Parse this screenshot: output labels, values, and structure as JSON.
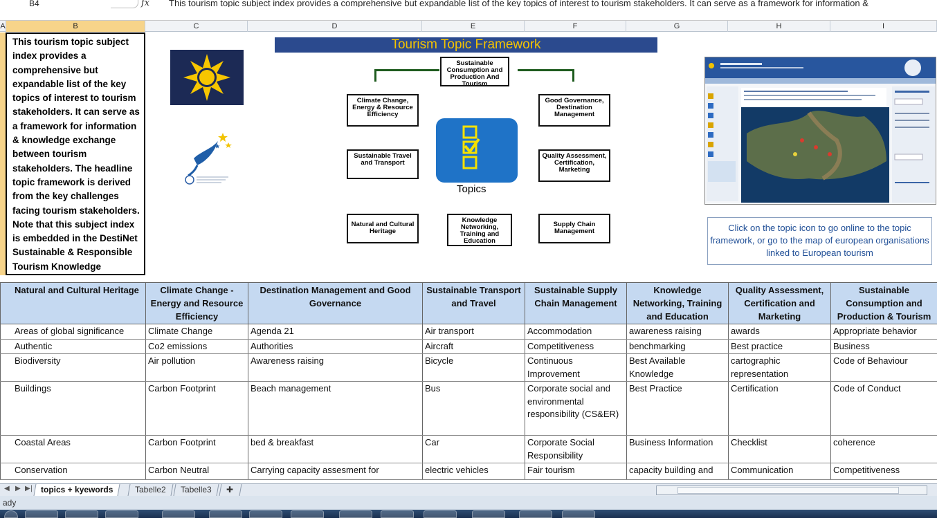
{
  "formula_bar": {
    "cell_ref": "B4",
    "fx_label": "fx",
    "formula": "This tourism topic subject index provides a comprehensive but expandable list of the key topics of interest to tourism stakeholders. It can serve as a framework for information &"
  },
  "columns": [
    "A",
    "B",
    "C",
    "D",
    "E",
    "F",
    "G",
    "H",
    "I"
  ],
  "description_text": "This tourism topic subject index provides a comprehensive but expandable list of the key topics of interest to tourism stakeholders. It can serve as a framework for information & knowledge exchange between tourism stakeholders. The headline topic framework is derived from the key challenges facing tourism stakeholders. Note that this subject index is embedded in the DestiNet Sustainable & Responsible Tourism Knowledge Networking Portal.",
  "framework": {
    "title": "Tourism Topic Framework",
    "center_label": "Topics",
    "boxes": {
      "top": "Sustainable Consumption and Production And Tourism",
      "left1": "Climate Change, Energy & Resource Efficiency",
      "right1": "Good Governance, Destination Management",
      "left2": "Sustainable Travel and Transport",
      "right2": "Quality Assessment, Certification, Marketing",
      "bottom_left": "Natural and Cultural Heritage",
      "bottom_mid": "Knowledge Networking, Training and Education",
      "bottom_right": "Supply Chain Management"
    }
  },
  "info_box": "Click on the topic icon to go online to the topic framework, or go to the map of european organisations linked to  European tourism",
  "table": {
    "headers": [
      "Natural and Cultural Heritage",
      "Climate Change - Energy and Resource Efficiency",
      "Destination Management and Good Governance",
      "Sustainable Transport and Travel",
      "Sustainable Supply Chain Management",
      "Knowledge Networking, Training and Education",
      "Quality Assessment, Certification and Marketing",
      "Sustainable Consumption and Production & Tourism"
    ],
    "rows": [
      [
        "Areas of global significance",
        "Climate Change",
        "Agenda 21",
        "Air transport",
        "Accommodation",
        "awareness raising",
        "awards",
        "Appropriate behavior"
      ],
      [
        "Authentic",
        " Co2 emissions",
        "Authorities",
        "Aircraft",
        "Competitiveness",
        "benchmarking",
        "Best practice",
        "Business"
      ],
      [
        "Biodiversity",
        "Air pollution",
        "Awareness raising",
        "Bicycle",
        "Continuous Improvement",
        "Best Available Knowledge",
        "cartographic representation",
        "Code of Behaviour"
      ],
      [
        "Buildings",
        "Carbon Footprint",
        "Beach management",
        "Bus",
        "Corporate social and environmental responsibility (CS&ER)",
        "Best Practice",
        "Certification",
        "Code of Conduct"
      ],
      [
        "Coastal Areas",
        "Carbon Footprint",
        "bed & breakfast",
        "Car",
        "Corporate Social Responsibility",
        "Business Information",
        "Checklist",
        "coherence"
      ],
      [
        "Conservation",
        "Carbon Neutral",
        "Carrying capacity assesment for",
        "electric vehicles",
        "Fair tourism",
        "capacity building and",
        "Communication",
        "Competitiveness"
      ]
    ]
  },
  "sheet_tabs": [
    "topics + kyewords",
    "Tabelle2",
    "Tabelle3"
  ],
  "status": "ady",
  "colors": {
    "header_fill": "#c5d9f1",
    "banner": "#2b4a8e",
    "banner_text": "#f5c400",
    "topics_button": "#1f73c7"
  }
}
